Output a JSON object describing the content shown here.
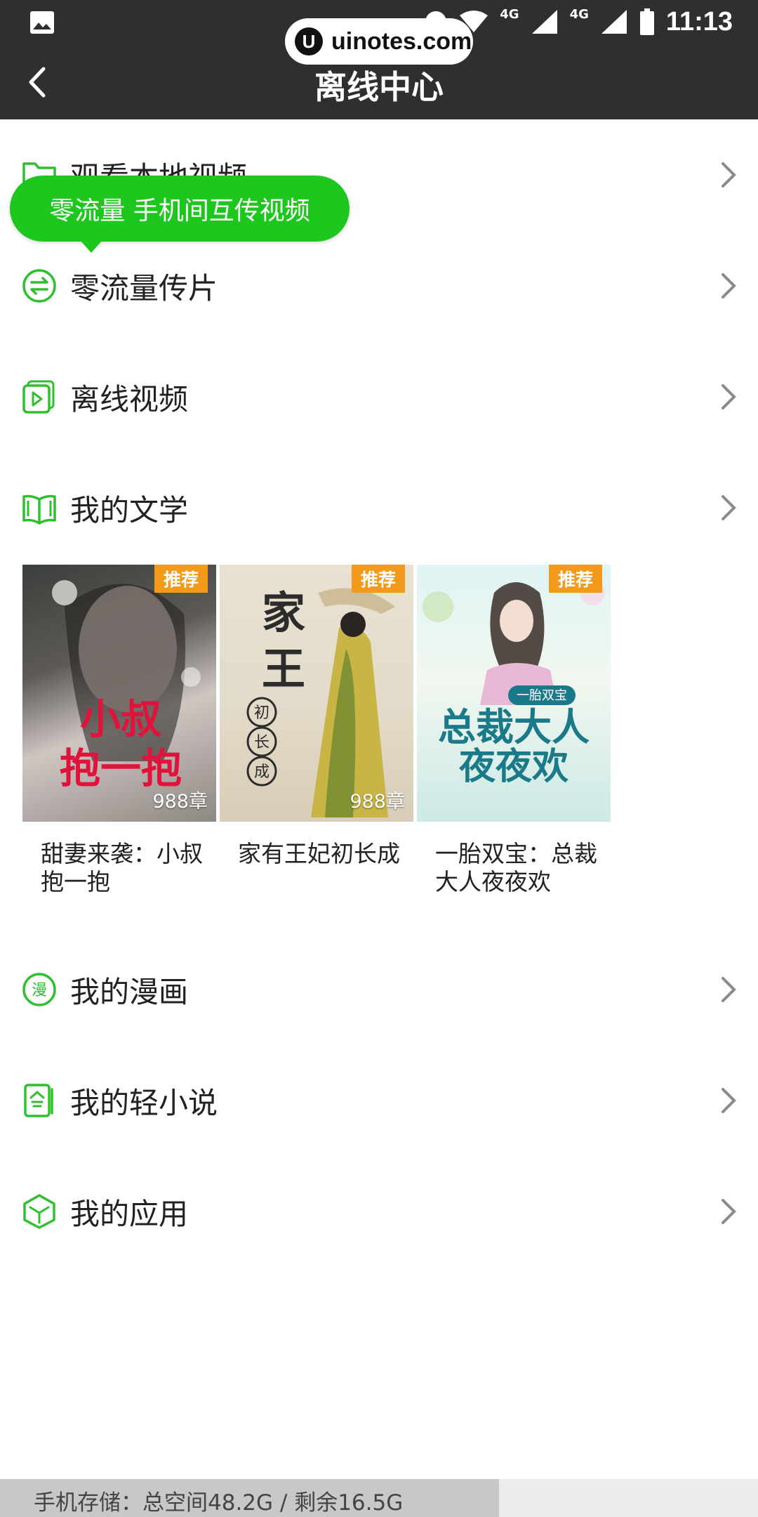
{
  "status_bar": {
    "time": "11:13",
    "network_1": "4G",
    "network_2": "4G"
  },
  "watermark": {
    "text": "uinotes.com"
  },
  "header": {
    "title": "离线中心"
  },
  "tooltip": {
    "text": "零流量 手机间互传视频"
  },
  "rows": [
    {
      "label": "观看本地视频",
      "icon": "folder-icon"
    },
    {
      "label": "零流量传片",
      "icon": "transfer-icon"
    },
    {
      "label": "离线视频",
      "icon": "play-video-icon"
    },
    {
      "label": "我的文学",
      "icon": "book-icon"
    },
    {
      "label": "我的漫画",
      "icon": "comic-icon"
    },
    {
      "label": "我的轻小说",
      "icon": "light-novel-icon"
    },
    {
      "label": "我的应用",
      "icon": "app-cube-icon"
    }
  ],
  "books": [
    {
      "title": "甜妻来袭：小叔抱一抱",
      "badge": "推荐",
      "chapters": "988章",
      "cover_text": "小叔抱一抱"
    },
    {
      "title": "家有王妃初长成",
      "badge": "推荐",
      "chapters": "988章",
      "cover_text": "家有王妃"
    },
    {
      "title": "一胎双宝：总裁大人夜夜欢",
      "badge": "推荐",
      "chapters": "",
      "cover_text": "总裁大人夜夜欢"
    }
  ],
  "storage": {
    "text": "手机存储：总空间48.2G / 剩余16.5G",
    "used_fraction": 0.658
  },
  "colors": {
    "header_bg": "#2f2f31",
    "accent_green": "#1ec71e",
    "badge_orange": "#f39a1a"
  }
}
